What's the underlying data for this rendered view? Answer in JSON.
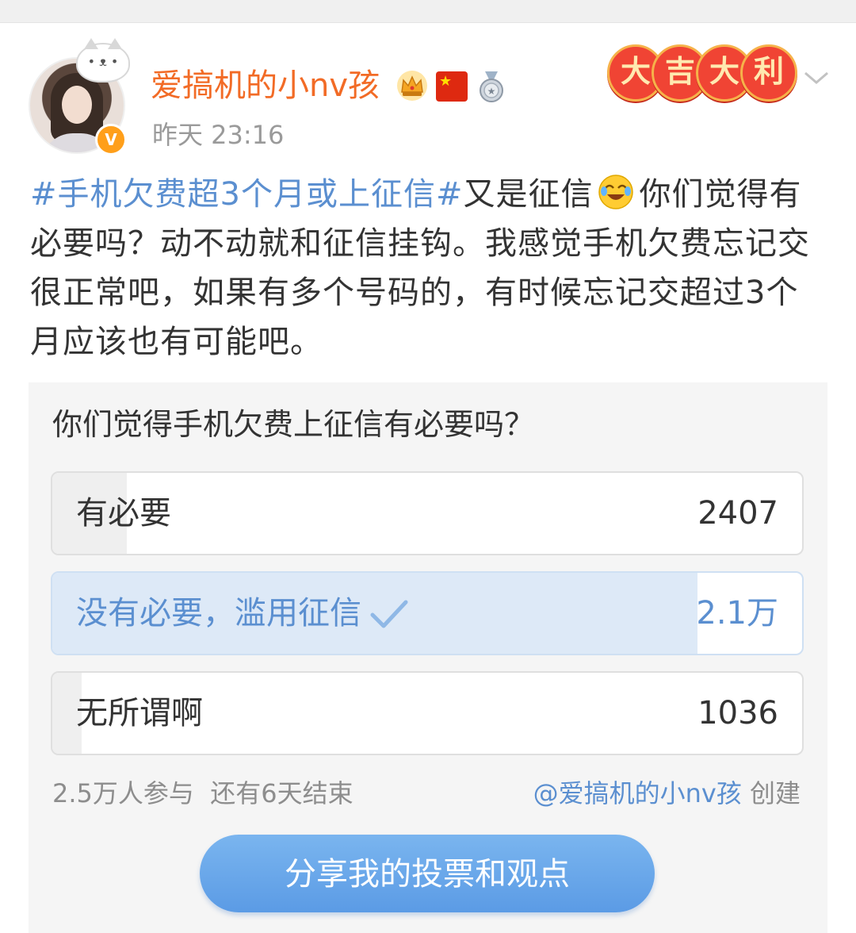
{
  "user": {
    "name": "爱搞机的小nv孩",
    "verified_badge": "V",
    "timestamp": "昨天 23:16",
    "badges": [
      "crown-icon",
      "china-flag-icon",
      "medal-icon"
    ]
  },
  "lucky_badge": [
    "大",
    "吉",
    "大",
    "利"
  ],
  "post": {
    "hashtag": "#手机欠费超3个月或上征信#",
    "text_before_emoji": "又是征信",
    "text_after_emoji": "你们觉得有必要吗？动不动就和征信挂钩。我感觉手机欠费忘记交很正常吧，如果有多个号码的，有时候忘记交超过3个月应该也有可能吧。"
  },
  "poll": {
    "question": "你们觉得手机欠费上征信有必要吗？",
    "options": [
      {
        "label": "有必要",
        "count": "2407",
        "share": 0.099,
        "voted": false
      },
      {
        "label": "没有必要，滥用征信",
        "count": "2.1万",
        "share": 0.86,
        "voted": true
      },
      {
        "label": "无所谓啊",
        "count": "1036",
        "share": 0.039,
        "voted": false
      }
    ],
    "participants": "2.5万人参与",
    "remaining": "还有6天结束",
    "creator": "@爱搞机的小nv孩",
    "creator_suffix": "创建",
    "share_label": "分享我的投票和观点"
  },
  "colors": {
    "username": "#f26b26",
    "link": "#5b8fd0",
    "voted_fill": "#dde9f7",
    "button": "#5b9be5"
  }
}
